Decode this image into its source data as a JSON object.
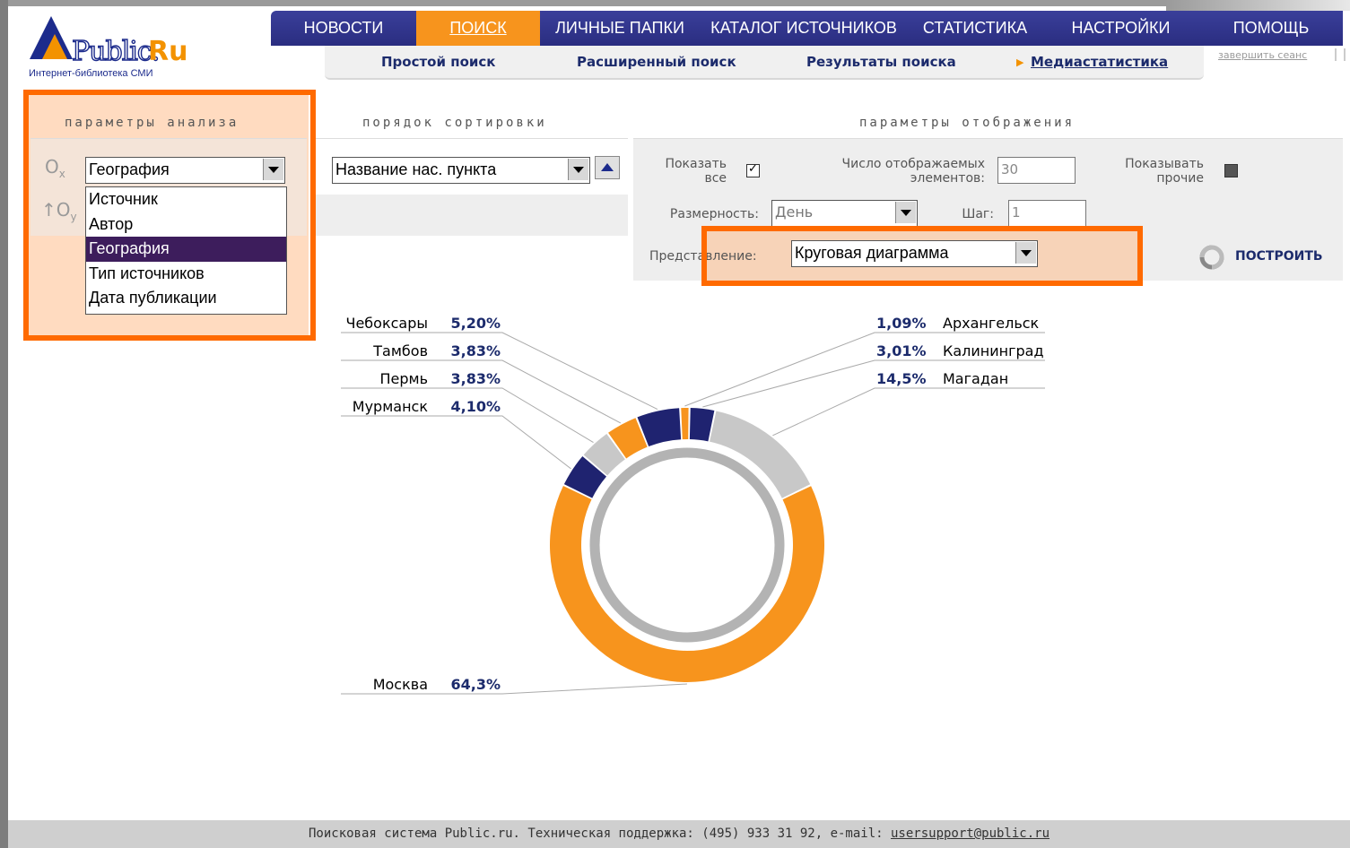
{
  "logo": {
    "name": "Public.",
    "ru": "Ru",
    "subtitle": "Интернет-библиотека СМИ"
  },
  "main_nav": [
    "НОВОСТИ",
    "ПОИСК",
    "ЛИЧНЫЕ ПАПКИ",
    "КАТАЛОГ ИСТОЧНИКОВ",
    "СТАТИСТИКА",
    "НАСТРОЙКИ",
    "ПОМОЩЬ"
  ],
  "main_nav_active": "ПОИСК",
  "sub_nav": [
    "Простой поиск",
    "Расширенный поиск",
    "Результаты поиска",
    "Медиастатистика"
  ],
  "end_session": "завершить сеанс",
  "analysis": {
    "header": "параметры анализа",
    "ox_label": "Ox",
    "oy_label": "Oy",
    "ox_value": "География",
    "options": [
      "Источник",
      "Автор",
      "География",
      "Тип источников",
      "Дата публикации"
    ],
    "selected_option": "География"
  },
  "sort": {
    "header": "порядок сортировки",
    "value": "Название нас. пункта"
  },
  "display": {
    "header": "параметры отображения",
    "show_all_label": "Показать все",
    "show_all_checked": true,
    "count_label": "Число отображаемых элементов:",
    "count_value": "30",
    "show_other_label": "Показывать прочие",
    "show_other_checked": false,
    "dimension_label": "Размерность:",
    "dimension_value": "День",
    "step_label": "Шаг:",
    "step_value": "1",
    "representation_label": "Представление:",
    "representation_value": "Круговая диаграмма",
    "build_button": "ПОСТРОИТЬ"
  },
  "chart_data": {
    "type": "pie",
    "slices": [
      {
        "name": "Москва",
        "value": 64.3,
        "label": "64,3%",
        "color": "#f7941d"
      },
      {
        "name": "Мурманск",
        "value": 4.1,
        "label": "4,10%",
        "color": "#1f2370"
      },
      {
        "name": "Пермь",
        "value": 3.83,
        "label": "3,83%",
        "color": "#c8c8c8"
      },
      {
        "name": "Тамбов",
        "value": 3.83,
        "label": "3,83%",
        "color": "#f7941d"
      },
      {
        "name": "Чебоксары",
        "value": 5.2,
        "label": "5,20%",
        "color": "#1f2370"
      },
      {
        "name": "Архангельск",
        "value": 1.09,
        "label": "1,09%",
        "color": "#f7941d"
      },
      {
        "name": "Калининград",
        "value": 3.01,
        "label": "3,01%",
        "color": "#1f2370"
      },
      {
        "name": "Магадан",
        "value": 14.5,
        "label": "14,5%",
        "color": "#c8c8c8"
      }
    ]
  },
  "footer": {
    "text": "Поисковая система Public.ru. Техническая поддержка: (495) 933 31 92, e-mail: ",
    "email": "usersupport@public.ru"
  }
}
